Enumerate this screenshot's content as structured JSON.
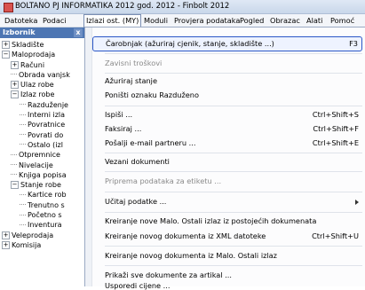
{
  "window": {
    "title": "BOLTANO PJ INFORMATIKA 2012 god. 2012 - Finbolt 2012"
  },
  "menubar": [
    {
      "label": "Datoteka"
    },
    {
      "label": "Podaci"
    },
    {
      "label": "Izlazi ost. (MY)"
    },
    {
      "label": "Moduli"
    },
    {
      "label": "Provjera podataka"
    },
    {
      "label": "Pogled"
    },
    {
      "label": "Obrazac"
    },
    {
      "label": "Alati"
    },
    {
      "label": "Pomoć"
    }
  ],
  "sidebar": {
    "title": "Izbornik",
    "close_label": "x",
    "tree": [
      {
        "label": "Skladište",
        "expander": "+"
      },
      {
        "label": "Maloprodaja",
        "expander": "−"
      },
      {
        "label": "Računi",
        "expander": "+"
      },
      {
        "label": "Obrada vanjsk",
        "expander": ""
      },
      {
        "label": "Ulaz robe",
        "expander": "+"
      },
      {
        "label": "Izlaz robe",
        "expander": "−"
      },
      {
        "label": "Razduženje",
        "expander": ""
      },
      {
        "label": "Interni izla",
        "expander": ""
      },
      {
        "label": "Povratnice",
        "expander": ""
      },
      {
        "label": "Povrati do",
        "expander": ""
      },
      {
        "label": "Ostalo (izl",
        "expander": ""
      },
      {
        "label": "Otpremnice",
        "expander": ""
      },
      {
        "label": "Nivelacije",
        "expander": ""
      },
      {
        "label": "Knjiga popisa",
        "expander": ""
      },
      {
        "label": "Stanje robe",
        "expander": "−"
      },
      {
        "label": "Kartice rob",
        "expander": ""
      },
      {
        "label": "Trenutno s",
        "expander": ""
      },
      {
        "label": "Početno s",
        "expander": ""
      },
      {
        "label": "Inventura",
        "expander": ""
      },
      {
        "label": "Veleprodaja",
        "expander": "+"
      },
      {
        "label": "Komisija",
        "expander": "+"
      }
    ]
  },
  "dropdown": {
    "items": [
      {
        "label": "Čarobnjak (ažuriraj cjenik, stanje, skladište ...)",
        "shortcut": "F3",
        "highlighted": true
      },
      {
        "label": "Zavisni troškovi",
        "disabled": true
      },
      {
        "label": "Ažuriraj stanje"
      },
      {
        "label": "Poništi oznaku Razduženo"
      },
      {
        "label": "Ispiši ...",
        "shortcut": "Ctrl+Shift+S"
      },
      {
        "label": "Faksiraj ...",
        "shortcut": "Ctrl+Shift+F"
      },
      {
        "label": "Pošalji e-mail partneru ...",
        "shortcut": "Ctrl+Shift+E"
      },
      {
        "label": "Vezani dokumenti"
      },
      {
        "label": "Priprema podataka za etiketu ...",
        "disabled": true
      },
      {
        "label": "Učitaj podatke ...",
        "submenu": true
      },
      {
        "label": "Kreiranje nove Malo. Ostali izlaz iz postojećih dokumenata"
      },
      {
        "label": "Kreiranje novog dokumenta iz XML datoteke",
        "shortcut": "Ctrl+Shift+U"
      },
      {
        "label": "Kreiranje novog dokumenta iz Malo. Ostali izlaz"
      },
      {
        "label": "Prikaži sve dokumente za artikal ..."
      },
      {
        "label": "Usporedi cijene ..."
      }
    ]
  }
}
